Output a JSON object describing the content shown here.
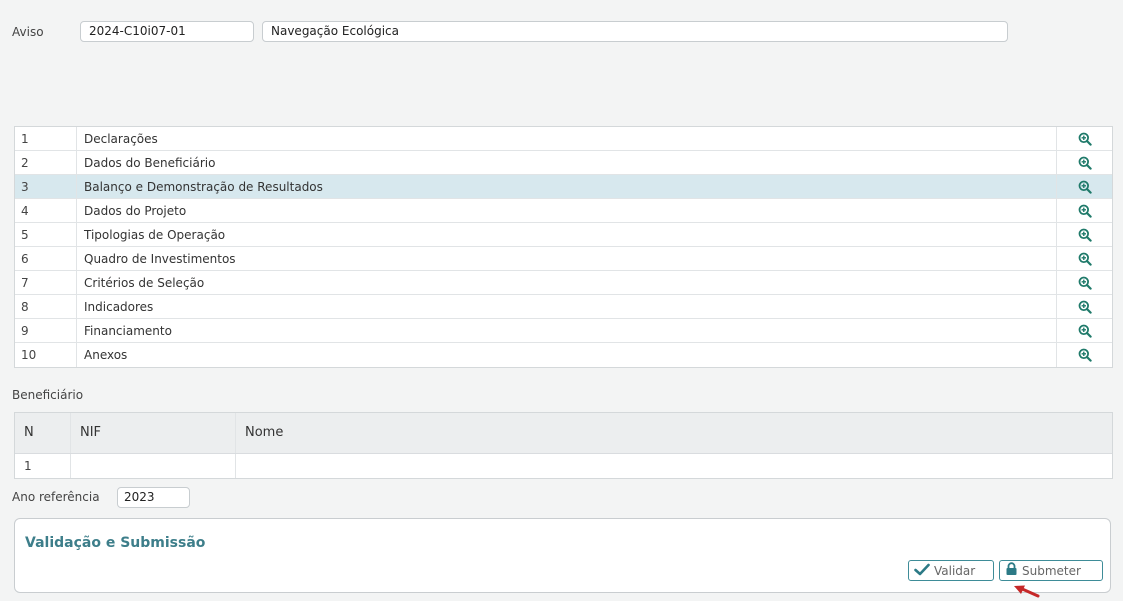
{
  "aviso": {
    "label": "Aviso",
    "code": "2024-C10i07-01",
    "name": "Navegação Ecológica"
  },
  "sections": [
    {
      "num": "1",
      "label": "Declarações"
    },
    {
      "num": "2",
      "label": "Dados do Beneficiário"
    },
    {
      "num": "3",
      "label": "Balanço e Demonstração de Resultados"
    },
    {
      "num": "4",
      "label": "Dados do Projeto"
    },
    {
      "num": "5",
      "label": "Tipologias de Operação"
    },
    {
      "num": "6",
      "label": "Quadro de Investimentos"
    },
    {
      "num": "7",
      "label": "Critérios de Seleção"
    },
    {
      "num": "8",
      "label": "Indicadores"
    },
    {
      "num": "9",
      "label": "Financiamento"
    },
    {
      "num": "10",
      "label": "Anexos"
    }
  ],
  "selected_section": "3",
  "beneficiario": {
    "title": "Beneficiário",
    "headers": {
      "n": "N",
      "nif": "NIF",
      "nome": "Nome"
    },
    "rows": [
      {
        "n": "1",
        "nif": "",
        "nome": ""
      }
    ]
  },
  "ano_referencia": {
    "label": "Ano referência",
    "value": "2023"
  },
  "validacao": {
    "title": "Validação e Submissão",
    "validar_label": "Validar",
    "submeter_label": "Submeter"
  },
  "colors": {
    "accent": "#3d7e8a",
    "icon": "#1f7a6a",
    "selected_row": "#d7e8ee",
    "arrow": "#c62828"
  },
  "icons": {
    "row_action": "zoom-in-icon",
    "validar": "check-icon",
    "submeter": "lock-icon"
  }
}
